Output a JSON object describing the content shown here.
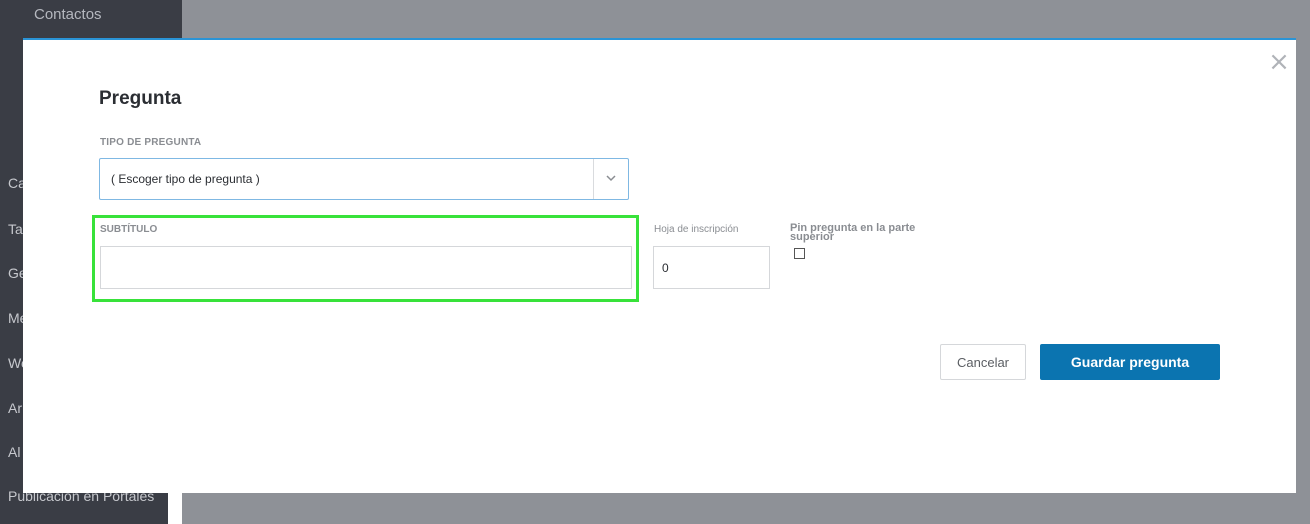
{
  "background": {
    "sidebar_top": "Contactos",
    "sidebar_items": [
      "Ca",
      "Ta",
      "Ge",
      "Me",
      "We",
      "Ar",
      "Al",
      "Publicación en Portales"
    ]
  },
  "modal": {
    "title": "Pregunta",
    "close_icon": "close-icon",
    "question_type": {
      "label": "TIPO DE PREGUNTA",
      "selected": "( Escoger tipo de pregunta )"
    },
    "subtitle": {
      "label": "SUBTÍTULO",
      "value": ""
    },
    "signup_sheet": {
      "label": "Hoja de inscripción",
      "value": "0"
    },
    "pin": {
      "label": "Pin pregunta en la parte superior",
      "checked": false
    },
    "buttons": {
      "cancel": "Cancelar",
      "save": "Guardar pregunta"
    }
  },
  "colors": {
    "accent": "#0b74b0",
    "modal_border": "#2a94d6",
    "highlight": "#38e23a",
    "sidebar": "#3a3d45"
  }
}
